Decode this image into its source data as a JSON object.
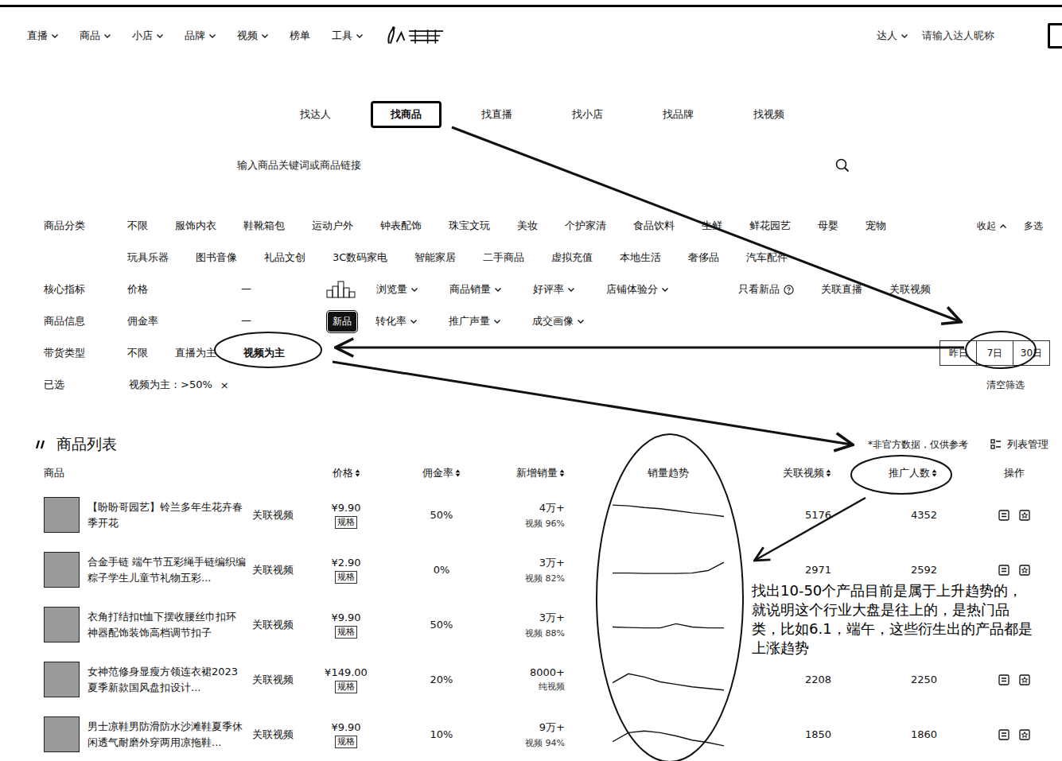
{
  "nav": {
    "items": [
      {
        "label": "直播",
        "has_menu": true
      },
      {
        "label": "商品",
        "has_menu": true
      },
      {
        "label": "小店",
        "has_menu": true
      },
      {
        "label": "品牌",
        "has_menu": true
      },
      {
        "label": "视频",
        "has_menu": true
      },
      {
        "label": "榜单",
        "has_menu": false
      },
      {
        "label": "工具",
        "has_menu": true
      }
    ],
    "user_menu": {
      "label": "达人",
      "has_menu": true
    },
    "search_placeholder": "请输入达人昵称"
  },
  "search_tabs": [
    {
      "label": "找达人",
      "selected": false
    },
    {
      "label": "找商品",
      "selected": true
    },
    {
      "label": "找直播",
      "selected": false
    },
    {
      "label": "找小店",
      "selected": false
    },
    {
      "label": "找品牌",
      "selected": false
    },
    {
      "label": "找视频",
      "selected": false
    }
  ],
  "search": {
    "placeholder": "输入商品关键词或商品链接"
  },
  "filters": {
    "category": {
      "label": "商品分类",
      "rows": [
        [
          {
            "label": "不限",
            "selected": false
          },
          {
            "label": "服饰内衣",
            "selected": false
          },
          {
            "label": "鞋靴箱包",
            "selected": false
          },
          {
            "label": "运动户外",
            "selected": false
          },
          {
            "label": "钟表配饰",
            "selected": false
          },
          {
            "label": "珠宝文玩",
            "selected": false
          },
          {
            "label": "美妆",
            "selected": false
          },
          {
            "label": "个护家清",
            "selected": false
          },
          {
            "label": "食品饮料",
            "selected": false
          },
          {
            "label": "生鲜",
            "selected": false
          },
          {
            "label": "鲜花园艺",
            "selected": false
          },
          {
            "label": "母婴",
            "selected": false
          },
          {
            "label": "宠物",
            "selected": false
          }
        ],
        [
          {
            "label": "玩具乐器",
            "selected": false
          },
          {
            "label": "图书音像",
            "selected": false
          },
          {
            "label": "礼品文创",
            "selected": false
          },
          {
            "label": "3C数码家电",
            "selected": false
          },
          {
            "label": "智能家居",
            "selected": false
          },
          {
            "label": "二手商品",
            "selected": false
          },
          {
            "label": "虚拟充值",
            "selected": false
          },
          {
            "label": "本地生活",
            "selected": false
          },
          {
            "label": "奢侈品",
            "selected": false
          },
          {
            "label": "汽车配件",
            "selected": false
          }
        ]
      ],
      "collapse": "收起",
      "multi": "多选"
    },
    "metrics": {
      "label": "核心指标",
      "range": {
        "label": "价格",
        "separator": "—"
      },
      "dropdowns": [
        "浏览量",
        "商品销量",
        "好评率",
        "店铺体验分"
      ],
      "toggles": [
        {
          "label": "只看新品",
          "has_info": true
        },
        {
          "label": "关联直播",
          "has_info": false
        },
        {
          "label": "关联视频",
          "has_info": false
        }
      ]
    },
    "info": {
      "label": "商品信息",
      "range": {
        "label": "佣金率",
        "separator": "—"
      },
      "badge": "新品",
      "dropdowns": [
        "转化率",
        "推广声量",
        "成交画像"
      ]
    },
    "carry_type": {
      "label": "带货类型",
      "options": [
        {
          "label": "不限",
          "selected": false
        },
        {
          "label": "直播为主",
          "selected": false
        },
        {
          "label": "视频为主",
          "selected": true
        }
      ]
    },
    "periods": [
      {
        "label": "昨日",
        "selected": false
      },
      {
        "label": "7日",
        "selected": false
      },
      {
        "label": "30日",
        "selected": false
      }
    ],
    "applied": {
      "label": "已选",
      "chips": [
        {
          "label": "视频为主：>50%",
          "remove": "×"
        }
      ],
      "clear": "清空筛选"
    }
  },
  "table": {
    "title": "商品列表",
    "note": "*非官方数据，仅供参考",
    "manage": "列表管理",
    "columns": [
      {
        "label": "商品",
        "sortable": false
      },
      {
        "label": "价格",
        "sortable": true
      },
      {
        "label": "佣金率",
        "sortable": true
      },
      {
        "label": "新增销量",
        "sortable": true
      },
      {
        "label": "销量趋势",
        "sortable": false
      },
      {
        "label": "关联视频",
        "sortable": true
      },
      {
        "label": "推广人数",
        "sortable": true
      },
      {
        "label": "操作",
        "sortable": false
      }
    ],
    "rows": [
      {
        "name": "【盼盼哥园艺】铃兰多年生花卉春季开花",
        "link": "关联视频",
        "price": "¥9.90",
        "spec": "规格",
        "commission": "50%",
        "sales": "4万+",
        "sales_note": "视频 96%",
        "trend": [
          6.2,
          6.0,
          5.6,
          5.3,
          4.8,
          4.3,
          3.9,
          3.4
        ],
        "videos": "5176",
        "promoters": "4352"
      },
      {
        "name": "合金手链 端午节五彩绳手链编织编粽子学生儿童节礼物五彩...",
        "link": "关联视频",
        "price": "¥2.90",
        "spec": "规格",
        "commission": "0%",
        "sales": "3万+",
        "sales_note": "视频 82%",
        "trend": [
          3.0,
          3.0,
          2.9,
          2.9,
          2.9,
          3.0,
          3.6,
          5.6
        ],
        "videos": "2971",
        "promoters": "2592"
      },
      {
        "name": "衣角打结扣t恤下摆收腰丝巾扣环神器配饰装饰高档调节扣子",
        "link": "关联视频",
        "price": "¥9.90",
        "spec": "规格",
        "commission": "50%",
        "sales": "3万+",
        "sales_note": "视频 88%",
        "trend": [
          3.2,
          3.1,
          3.0,
          3.0,
          4.0,
          3.2,
          3.0,
          3.0
        ]
      },
      {
        "name": "女神范修身显瘦方领连衣裙2023夏季新款国风盘扣设计...",
        "link": "关联视频",
        "price": "¥149.00",
        "spec": "规格",
        "commission": "20%",
        "sales": "8000+",
        "sales_note": "纯视频",
        "trend": [
          3.0,
          5.2,
          4.4,
          3.2,
          2.6,
          2.0,
          1.6,
          1.2
        ],
        "videos": "2208",
        "promoters": "2250"
      },
      {
        "name": "男士凉鞋男防滑防水沙滩鞋夏季休闲透气耐磨外穿两用凉拖鞋...",
        "link": "关联视频",
        "price": "¥9.90",
        "spec": "规格",
        "commission": "10%",
        "sales": "9万+",
        "sales_note": "视频 94%",
        "trend": [
          2.0,
          4.2,
          4.6,
          4.2,
          3.4,
          2.4,
          1.8,
          1.0
        ],
        "videos": "1850",
        "promoters": "1860"
      }
    ]
  },
  "annotation": {
    "text": "找出10-50个产品目前是属于上升趋势的，就说明这个行业大盘是往上的，是热门品类，比如6.1，端午，这些衍生出的产品都是上涨趋势"
  }
}
